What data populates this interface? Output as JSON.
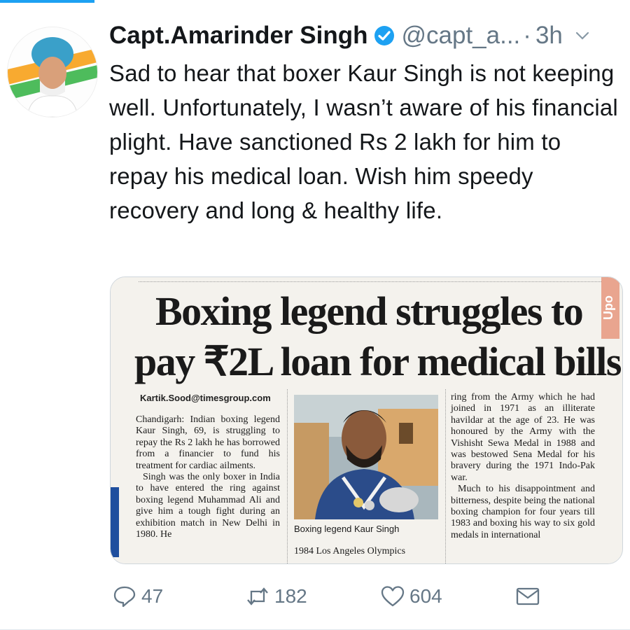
{
  "tweet": {
    "name": "Capt.Amarinder Singh",
    "handle": "@capt_a...",
    "separator": "·",
    "time": "3h",
    "text": "Sad to hear that boxer Kaur Singh is not keeping well. Unfortunately, I wasn’t aware of his financial plight. Have sanctioned Rs 2 lakh for him to repay his medical loan. Wish him speedy recovery and long & healthy life."
  },
  "newspaper": {
    "headline_line1": "Boxing legend struggles to",
    "headline_line2": "pay ₹2L loan for medical bills",
    "byline": "Kartik.Sood@timesgroup.com",
    "left_col_p1": "Chandigarh: Indian boxing legend Kaur Singh, 69, is struggling to repay the Rs 2 lakh he has borrowed from a financier to fund his treatment for cardiac ailments.",
    "left_col_p2": "Singh was the only boxer in India to have entered the ring against boxing legend Muhammad Ali and give him a tough fight during an exhibition match in New Delhi in 1980. He",
    "caption": "Boxing legend Kaur Singh",
    "mid_text": "1984 Los Angeles Olympics",
    "right_col_p1": "ring from the Army which he had joined in 1971 as an illiterate havildar at the age of 23. He was honoured by the Army with the Vishisht Sewa Medal in 1988 and was bestowed Sena Medal for his bravery during the 1971 Indo-Pak war.",
    "right_col_p2": "Much to his disappointment and bitterness, despite being the national boxing champion for four years till 1983 and boxing his way to six gold medals in international",
    "side_tab": "Upo"
  },
  "actions": {
    "reply_count": "47",
    "retweet_count": "182",
    "like_count": "604"
  },
  "icons": {
    "verified": "verified-badge-icon",
    "chevron": "chevron-down-icon",
    "reply": "reply-icon",
    "retweet": "retweet-icon",
    "like": "heart-icon",
    "dm": "mail-icon"
  },
  "colors": {
    "accent": "#1da1f2",
    "secondary_text": "#657786",
    "primary_text": "#14171a"
  }
}
